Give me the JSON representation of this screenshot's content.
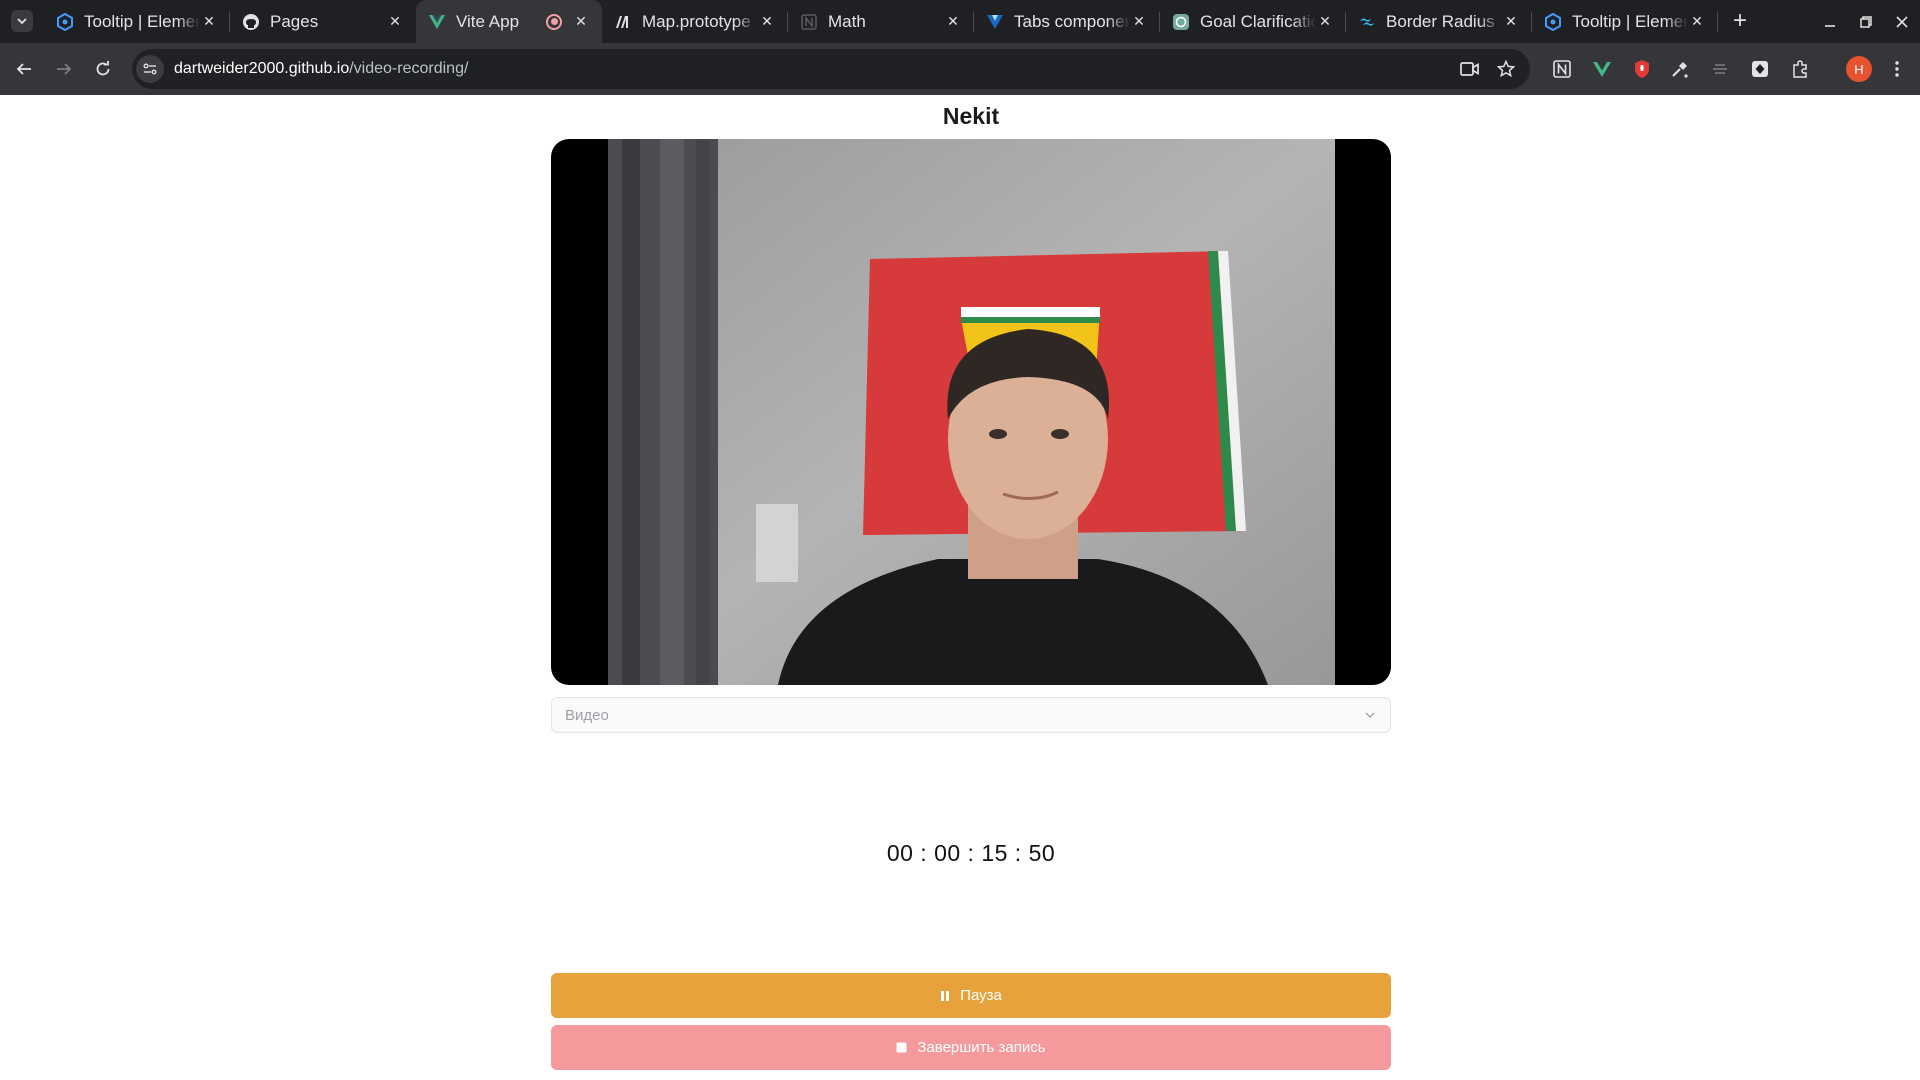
{
  "browser": {
    "tabs": [
      {
        "title": "Tooltip | Element",
        "favicon": "element-plus-icon",
        "active": false
      },
      {
        "title": "Pages",
        "favicon": "github-icon",
        "active": false
      },
      {
        "title": "Vite App",
        "favicon": "vue-icon",
        "active": true,
        "recording": true
      },
      {
        "title": "Map.prototype",
        "favicon": "mdn-icon",
        "active": false
      },
      {
        "title": "Math",
        "favicon": "notion-icon",
        "active": false
      },
      {
        "title": "Tabs component",
        "favicon": "vuetify-icon",
        "active": false
      },
      {
        "title": "Goal Clarification",
        "favicon": "chatgpt-icon",
        "active": false
      },
      {
        "title": "Border Radius",
        "favicon": "tailwind-icon",
        "active": false
      },
      {
        "title": "Tooltip | Element",
        "favicon": "element-plus-icon",
        "active": false
      }
    ],
    "url_host": "dartweider2000.github.io",
    "url_path": "/video-recording/",
    "profile_initial": "H"
  },
  "page": {
    "user_name": "Nekit",
    "source_select": {
      "value": "Видео"
    },
    "timer": "00 : 00 : 15 : 50",
    "pause_button": "Пауза",
    "stop_button": "Завершить запись"
  },
  "colors": {
    "pause": "#e8a23b",
    "stop": "#f59a9c",
    "tabstrip": "#1f2023",
    "toolbar": "#35363a"
  }
}
